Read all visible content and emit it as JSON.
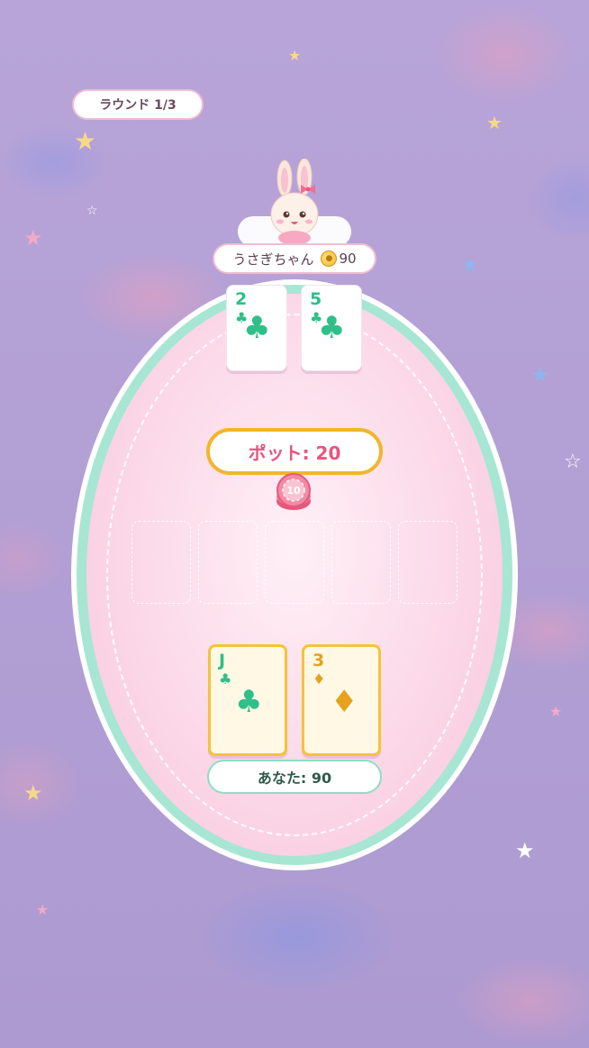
{
  "round": {
    "label": "ラウンド 1/3"
  },
  "opponent": {
    "name": "うさぎちゃん",
    "coins": "90",
    "cards": [
      {
        "rank": "2",
        "suit": "♣"
      },
      {
        "rank": "5",
        "suit": "♣"
      }
    ]
  },
  "pot": {
    "label": "ポット: 20",
    "chip_value": "10"
  },
  "player": {
    "label": "あなた: 90",
    "cards": [
      {
        "rank": "J",
        "suit": "♣"
      },
      {
        "rank": "3",
        "suit": "♦"
      }
    ]
  },
  "colors": {
    "club": "#2fbf88",
    "diamond": "#e6a11e",
    "pot_text": "#e8557e",
    "table_rim": "#a7e6d3"
  },
  "icons": {
    "coin": "coin-icon",
    "avatar": "bunny-avatar"
  }
}
